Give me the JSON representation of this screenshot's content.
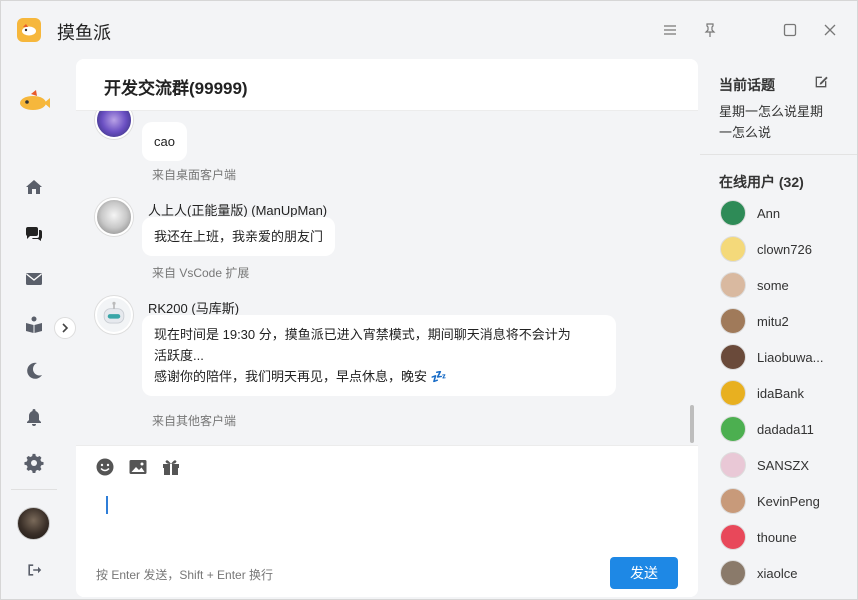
{
  "app": {
    "title": "摸鱼派",
    "brand_color": "#f6b73c"
  },
  "window_controls": [
    "menu-icon",
    "pin-icon",
    "maximize-icon",
    "close-icon"
  ],
  "nav": {
    "items": [
      "home-icon",
      "chat-icon",
      "mail-icon",
      "book-icon",
      "moon-icon",
      "bell-icon",
      "gear-icon"
    ],
    "bottom": [
      "avatar",
      "logout-icon"
    ]
  },
  "chat": {
    "title": "开发交流群(99999)",
    "messages": [
      {
        "name": "",
        "text": "cao",
        "client": "来自桌面客户端"
      },
      {
        "name": "人上人(正能量版) (ManUpMan)",
        "text": "我还在上班，我亲爱的朋友门",
        "client": "来自 VsCode 扩展"
      },
      {
        "name": "RK200 (马库斯)",
        "text_line1": "现在时间是 19:30 分，摸鱼派已进入宵禁模式，期间聊天消息将不会计为",
        "text_line2": "活跃度...",
        "text_line3": "感谢你的陪伴，我们明天再见，早点休息，晚安 💤",
        "client": "来自其他客户端"
      }
    ],
    "composer": {
      "tools": [
        "emoji-icon",
        "image-icon",
        "gift-icon"
      ],
      "hint": "按 Enter 发送，Shift + Enter 换行",
      "send_label": "发送"
    }
  },
  "topic": {
    "title": "当前话题",
    "text": "星期一怎么说星期一怎么说"
  },
  "online": {
    "title": "在线用户 (32)",
    "users": [
      {
        "name": "Ann",
        "color": "#2e8b57"
      },
      {
        "name": "clown726",
        "color": "#f4d97a"
      },
      {
        "name": "some",
        "color": "#d9b9a0"
      },
      {
        "name": "mitu2",
        "color": "#a07a5a"
      },
      {
        "name": "Liaobuwa...",
        "color": "#6a4a3a"
      },
      {
        "name": "idaBank",
        "color": "#e8b020"
      },
      {
        "name": "dadada11",
        "color": "#4caf50"
      },
      {
        "name": "SANSZX",
        "color": "#e9c8d6"
      },
      {
        "name": "KevinPeng",
        "color": "#c89a7a"
      },
      {
        "name": "thoune",
        "color": "#e8485a"
      },
      {
        "name": "xiaolce",
        "color": "#8a7a6a"
      }
    ]
  }
}
